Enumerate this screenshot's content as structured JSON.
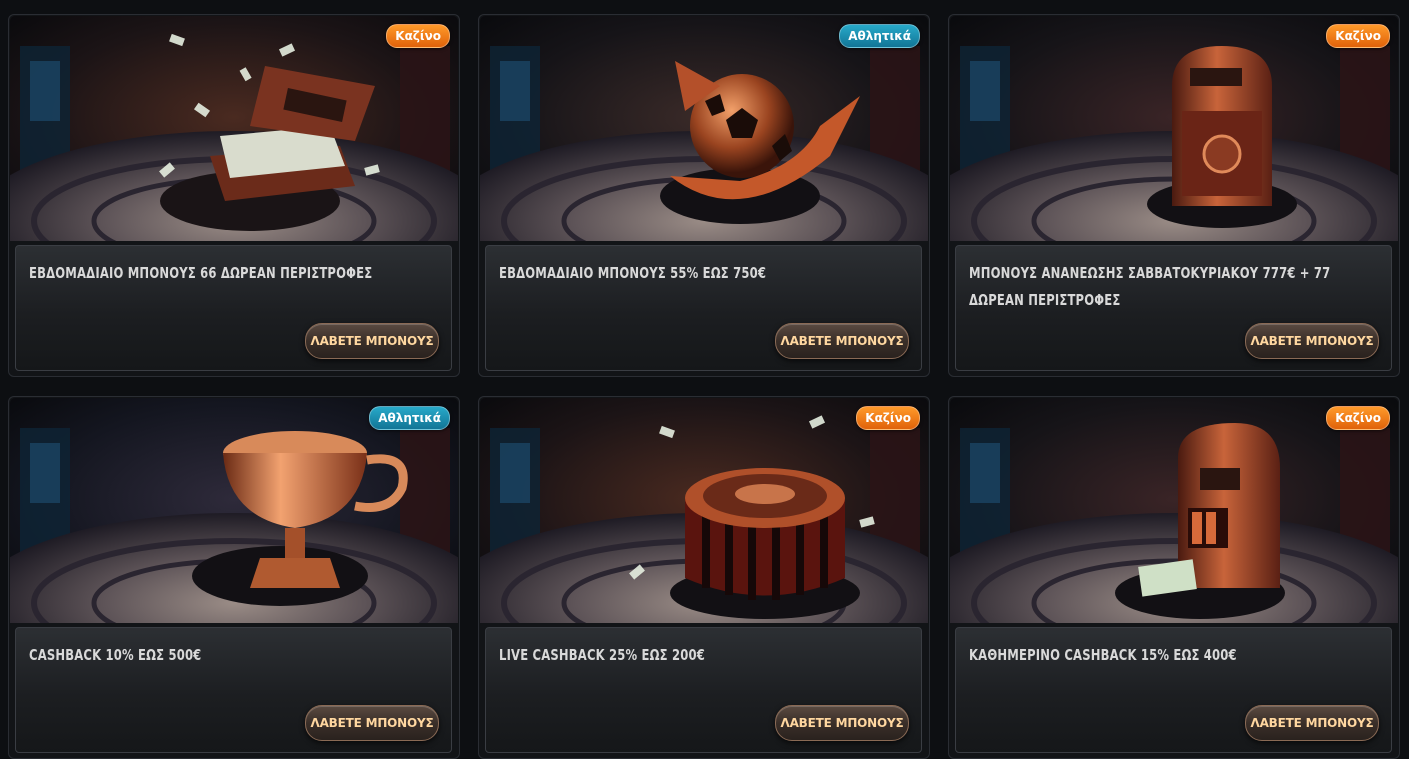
{
  "colors": {
    "page_background": "#0d0f12",
    "badge_casino": "#f07a12",
    "badge_sports": "#1b8fb3",
    "cta_text": "#ffd7a0",
    "title_text": "#d9d9d9"
  },
  "cards": [
    {
      "badge": "Καζίνο",
      "badge_type": "casino",
      "image": "money-suitcase",
      "title": "ΕΒΔΟΜΑΔΙΑΙΟ ΜΠΟΝΟΥΣ 66 ΔΩΡΕΑΝ ΠΕΡΙΣΤΡΟΦΕΣ",
      "cta": "ΛΑΒΕΤΕ ΜΠΟΝΟΥΣ"
    },
    {
      "badge": "Αθλητικά",
      "badge_type": "sports",
      "image": "football-arrow",
      "title": "ΕΒΔΟΜΑΔΙΑΙΟ ΜΠΟΝΟΥΣ 55% ΕΩΣ 750€",
      "cta": "ΛΑΒΕΤΕ ΜΠΟΝΟΥΣ"
    },
    {
      "badge": "Καζίνο",
      "badge_type": "casino",
      "image": "safe-box",
      "title": "ΜΠΟΝΟΥΣ ΑΝΑΝΕΩΣΗΣ ΣΑΒΒΑΤΟΚΥΡΙΑΚΟΥ 777€ + 77 ΔΩΡΕΑΝ ΠΕΡΙΣΤΡΟΦΕΣ",
      "cta": "ΛΑΒΕΤΕ ΜΠΟΝΟΥΣ"
    },
    {
      "badge": "Αθλητικά",
      "badge_type": "sports",
      "image": "trophy-cup",
      "title": "CASHBACK 10% ΕΩΣ 500€",
      "cta": "ΛΑΒΕΤΕ ΜΠΟΝΟΥΣ"
    },
    {
      "badge": "Καζίνο",
      "badge_type": "casino",
      "image": "roulette-wheel",
      "title": "LIVE CASHBACK 25% ΕΩΣ 200€",
      "cta": "ΛΑΒΕΤΕ ΜΠΟΝΟΥΣ"
    },
    {
      "badge": "Καζίνο",
      "badge_type": "casino",
      "image": "slot-machine",
      "title": "ΚΑΘΗΜΕΡΙΝΟ CASHBACK 15% ΕΩΣ 400€",
      "cta": "ΛΑΒΕΤΕ ΜΠΟΝΟΥΣ"
    }
  ]
}
